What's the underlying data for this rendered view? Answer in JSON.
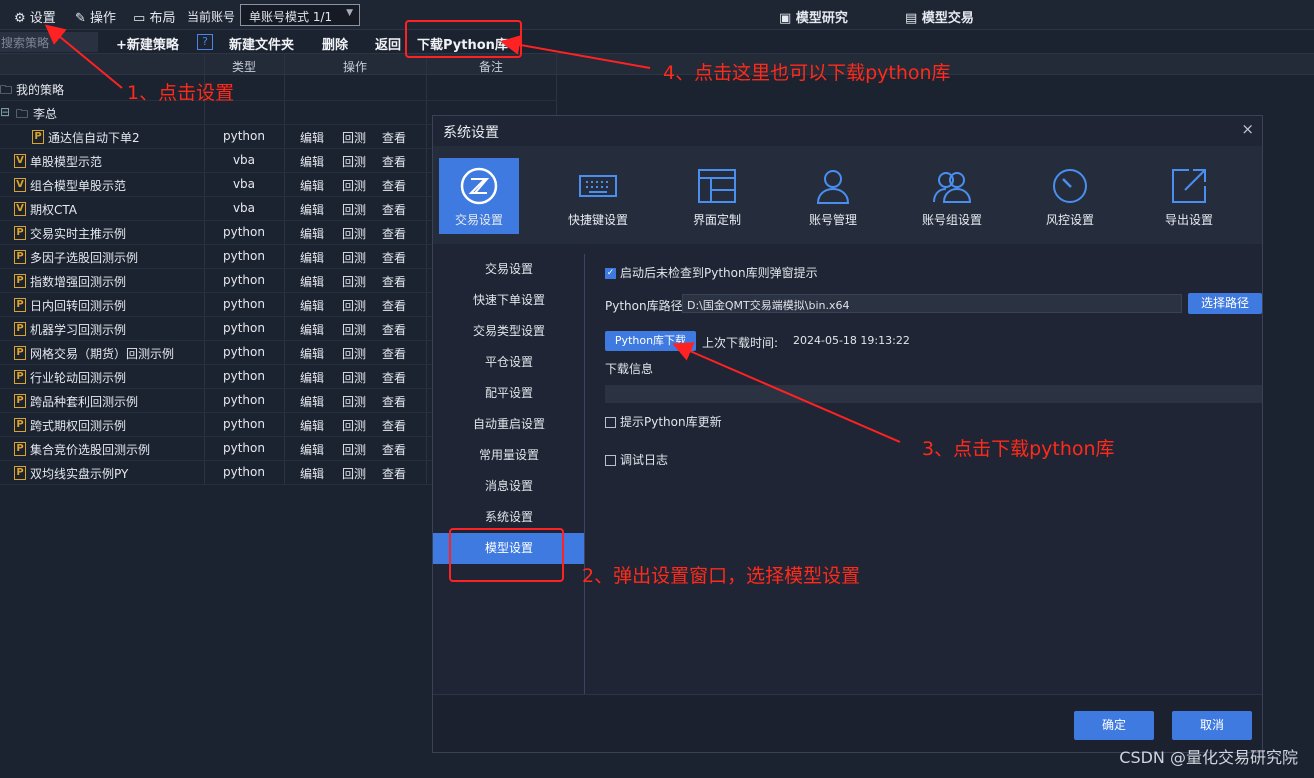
{
  "topbar": {
    "settings": "设置",
    "operate": "操作",
    "layout": "布局",
    "account_label": "当前账号",
    "account_mode": "单账号模式 1/1",
    "model_research": "模型研究",
    "model_trade": "模型交易"
  },
  "toolbar": {
    "search_placeholder": "搜索策略",
    "new_strategy": "+新建策略",
    "help": "?",
    "new_folder": "新建文件夹",
    "delete": "删除",
    "back": "返回",
    "download_python": "下载Python库"
  },
  "table": {
    "headers": {
      "type": "类型",
      "ops": "操作",
      "note": "备注"
    },
    "root": "我的策略",
    "folder": "李总",
    "rows": [
      {
        "name": "通达信自动下单2",
        "icon": "P",
        "type": "python"
      },
      {
        "name": "单股模型示范",
        "icon": "V",
        "type": "vba"
      },
      {
        "name": "组合模型单股示范",
        "icon": "V",
        "type": "vba"
      },
      {
        "name": "期权CTA",
        "icon": "V",
        "type": "vba"
      },
      {
        "name": "交易实时主推示例",
        "icon": "P",
        "type": "python"
      },
      {
        "name": "多因子选股回测示例",
        "icon": "P",
        "type": "python"
      },
      {
        "name": "指数增强回测示例",
        "icon": "P",
        "type": "python"
      },
      {
        "name": "日内回转回测示例",
        "icon": "P",
        "type": "python"
      },
      {
        "name": "机器学习回测示例",
        "icon": "P",
        "type": "python"
      },
      {
        "name": "网格交易（期货）回测示例",
        "icon": "P",
        "type": "python"
      },
      {
        "name": "行业轮动回测示例",
        "icon": "P",
        "type": "python"
      },
      {
        "name": "跨品种套利回测示例",
        "icon": "P",
        "type": "python"
      },
      {
        "name": "跨式期权回测示例",
        "icon": "P",
        "type": "python"
      },
      {
        "name": "集合竞价选股回测示例",
        "icon": "P",
        "type": "python"
      },
      {
        "name": "双均线实盘示例PY",
        "icon": "P",
        "type": "python"
      }
    ],
    "op_edit": "编辑",
    "op_backtest": "回测",
    "op_view": "查看"
  },
  "dialog": {
    "title": "系统设置",
    "close": "×",
    "icons": [
      {
        "label": "交易设置",
        "icon": "trade-settings-icon"
      },
      {
        "label": "快捷键设置",
        "icon": "keyboard-icon"
      },
      {
        "label": "界面定制",
        "icon": "layout-icon"
      },
      {
        "label": "账号管理",
        "icon": "user-icon"
      },
      {
        "label": "账号组设置",
        "icon": "users-icon"
      },
      {
        "label": "风控设置",
        "icon": "gauge-icon"
      },
      {
        "label": "导出设置",
        "icon": "export-icon"
      }
    ],
    "side": [
      "交易设置",
      "快速下单设置",
      "交易类型设置",
      "平仓设置",
      "配平设置",
      "自动重启设置",
      "常用量设置",
      "消息设置",
      "系统设置",
      "模型设置"
    ],
    "prompt_check": "启动后未检查到Python库则弹窗提示",
    "path_label": "Python库路径",
    "path_value": "D:\\国金QMT交易端模拟\\bin.x64",
    "choose_path": "选择路径",
    "download_btn": "Python库下载",
    "last_download_label": "上次下载时间:",
    "last_download_time": "2024-05-18 19:13:22",
    "download_info": "下载信息",
    "update_hint": "提示Python库更新",
    "debug_log": "调试日志",
    "ok": "确定",
    "cancel": "取消"
  },
  "annotations": {
    "a1": "1、点击设置",
    "a2": "2、弹出设置窗口，选择模型设置",
    "a3": "3、点击下载python库",
    "a4": "4、点击这里也可以下载python库"
  },
  "watermark": "CSDN @量化交易研究院",
  "colors": {
    "accent": "#3f7ae0",
    "annotation": "#ff2a1a",
    "bg": "#1b2230"
  }
}
